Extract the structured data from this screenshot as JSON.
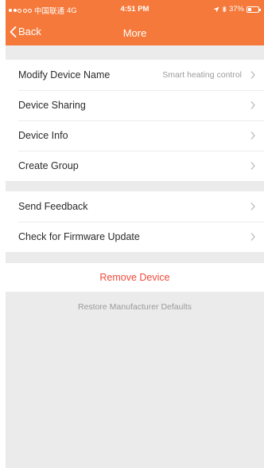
{
  "status_bar": {
    "carrier": "中国联通",
    "network": "4G",
    "time": "4:51 PM",
    "battery": "37%",
    "battery_level": 0.37
  },
  "nav": {
    "back_label": "Back",
    "title": "More"
  },
  "group1": {
    "items": [
      {
        "label": "Modify Device Name",
        "value": "Smart heating control"
      },
      {
        "label": "Device Sharing"
      },
      {
        "label": "Device Info"
      },
      {
        "label": "Create Group"
      }
    ]
  },
  "group2": {
    "items": [
      {
        "label": "Send Feedback"
      },
      {
        "label": "Check for Firmware Update"
      }
    ]
  },
  "actions": {
    "remove_device": "Remove Device",
    "restore_defaults": "Restore Manufacturer Defaults"
  },
  "colors": {
    "accent": "#f5793a",
    "destructive": "#f24a3a",
    "background": "#ebebeb"
  }
}
